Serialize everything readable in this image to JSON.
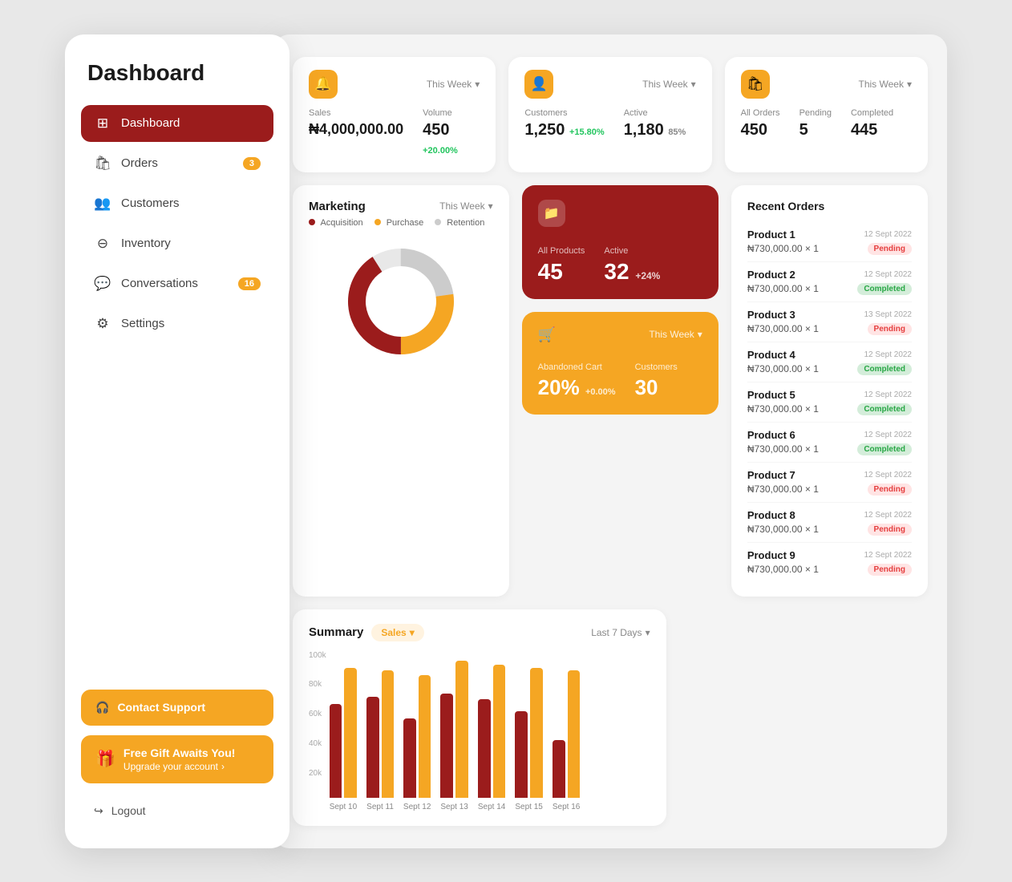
{
  "sidebar": {
    "title": "Dashboard",
    "nav_items": [
      {
        "id": "dashboard",
        "label": "Dashboard",
        "icon": "⊞",
        "active": true,
        "badge": null
      },
      {
        "id": "orders",
        "label": "Orders",
        "icon": "🛍",
        "active": false,
        "badge": "3"
      },
      {
        "id": "customers",
        "label": "Customers",
        "icon": "👥",
        "active": false,
        "badge": null
      },
      {
        "id": "inventory",
        "label": "Inventory",
        "icon": "⊖",
        "active": false,
        "badge": null
      },
      {
        "id": "conversations",
        "label": "Conversations",
        "icon": "💬",
        "active": false,
        "badge": "16"
      },
      {
        "id": "settings",
        "label": "Settings",
        "icon": "⚙",
        "active": false,
        "badge": null
      }
    ],
    "contact_support": "Contact Support",
    "gift_title": "Free Gift Awaits You!",
    "gift_sub": "Upgrade your account",
    "logout": "Logout"
  },
  "stats": {
    "sales": {
      "label_sales": "Sales",
      "label_volume": "Volume",
      "value_sales": "₦4,000,000.00",
      "value_volume": "450",
      "volume_badge": "+20.00%",
      "period": "This Week"
    },
    "customers": {
      "label_customers": "Customers",
      "label_active": "Active",
      "value_customers": "1,250",
      "customers_badge": "+15.80%",
      "value_active": "1,180",
      "active_percent": "85%",
      "period": "This Week"
    },
    "orders": {
      "label_all": "All Orders",
      "label_pending": "Pending",
      "label_completed": "Completed",
      "value_all": "450",
      "value_pending": "5",
      "value_completed": "445",
      "period": "This Week"
    }
  },
  "marketing": {
    "title": "Marketing",
    "period": "This Week",
    "legend": [
      {
        "label": "Acquisition",
        "color": "#9b1c1c"
      },
      {
        "label": "Purchase",
        "color": "#f5a623"
      },
      {
        "label": "Retention",
        "color": "#ccc"
      }
    ],
    "donut": {
      "acquisition_pct": 45,
      "purchase_pct": 30,
      "retention_pct": 25
    }
  },
  "products": {
    "label_all": "All Products",
    "label_active": "Active",
    "value_all": "45",
    "value_active": "32",
    "active_badge": "+24%"
  },
  "cart": {
    "label_abandoned": "Abandoned Cart",
    "label_customers": "Customers",
    "value_abandoned": "20%",
    "abandoned_badge": "+0.00%",
    "value_customers": "30",
    "period": "This Week"
  },
  "summary": {
    "title": "Summary",
    "filter": "Sales",
    "range": "Last 7 Days",
    "bars": [
      {
        "label": "Sept 10",
        "red": 65,
        "yellow": 90
      },
      {
        "label": "Sept 11",
        "red": 70,
        "yellow": 88
      },
      {
        "label": "Sept 12",
        "red": 55,
        "yellow": 85
      },
      {
        "label": "Sept 13",
        "red": 72,
        "yellow": 95
      },
      {
        "label": "Sept 14",
        "red": 68,
        "yellow": 92
      },
      {
        "label": "Sept 15",
        "red": 60,
        "yellow": 90
      },
      {
        "label": "Sept 16",
        "red": 40,
        "yellow": 88
      }
    ],
    "y_labels": [
      "100k",
      "80k",
      "60k",
      "40k",
      "20k"
    ]
  },
  "recent_orders": {
    "title": "Recent Orders",
    "items": [
      {
        "name": "Product 1",
        "price": "₦730,000.00 × 1",
        "date": "12 Sept 2022",
        "status": "Pending"
      },
      {
        "name": "Product 2",
        "price": "₦730,000.00 × 1",
        "date": "12 Sept 2022",
        "status": "Completed"
      },
      {
        "name": "Product 3",
        "price": "₦730,000.00 × 1",
        "date": "13 Sept 2022",
        "status": "Pending"
      },
      {
        "name": "Product 4",
        "price": "₦730,000.00 × 1",
        "date": "12 Sept 2022",
        "status": "Completed"
      },
      {
        "name": "Product 5",
        "price": "₦730,000.00 × 1",
        "date": "12 Sept 2022",
        "status": "Completed"
      },
      {
        "name": "Product 6",
        "price": "₦730,000.00 × 1",
        "date": "12 Sept 2022",
        "status": "Completed"
      },
      {
        "name": "Product 7",
        "price": "₦730,000.00 × 1",
        "date": "12 Sept 2022",
        "status": "Pending"
      },
      {
        "name": "Product 8",
        "price": "₦730,000.00 × 1",
        "date": "12 Sept 2022",
        "status": "Pending"
      },
      {
        "name": "Product 9",
        "price": "₦730,000.00 × 1",
        "date": "12 Sept 2022",
        "status": "Pending"
      }
    ]
  }
}
